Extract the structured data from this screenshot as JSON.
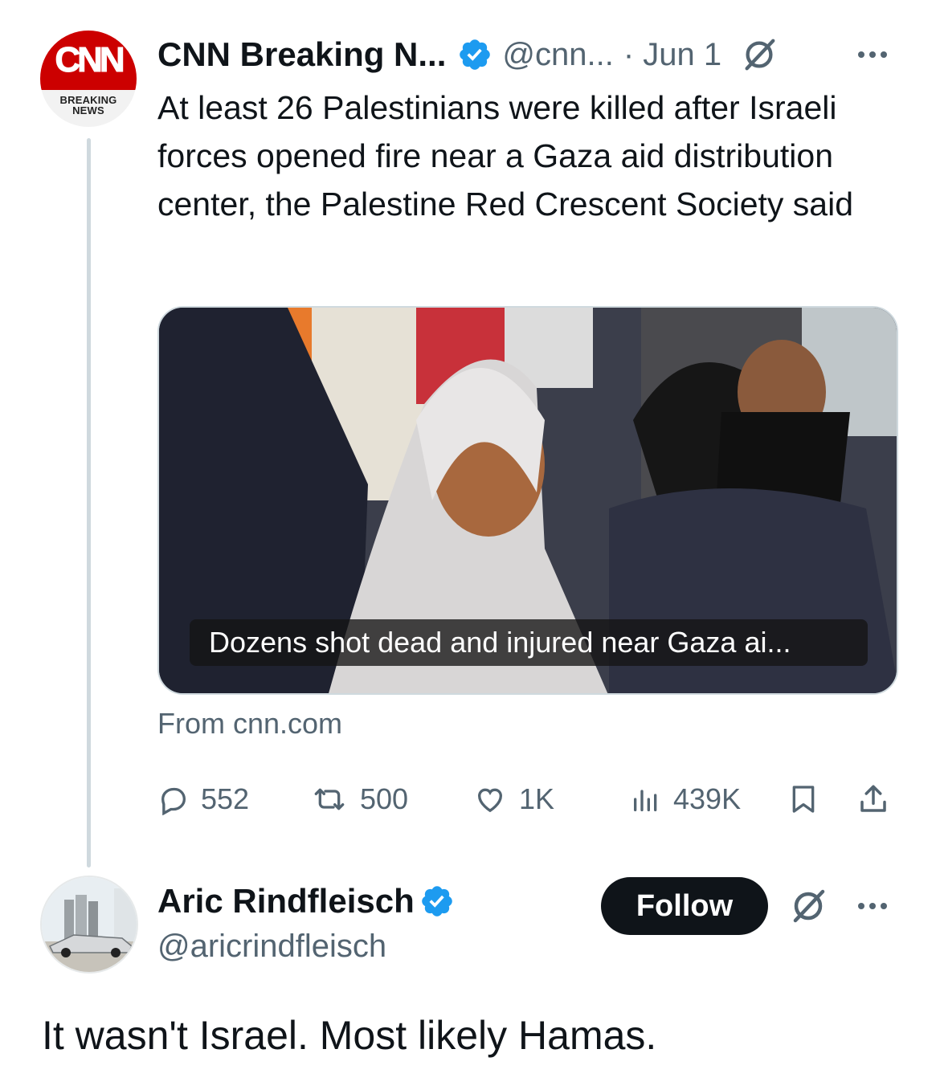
{
  "tweet": {
    "author_name": "CNN Breaking N...",
    "avatar_logo": "CNN",
    "avatar_caption_line1": "BREAKING",
    "avatar_caption_line2": "NEWS",
    "handle": "@cnn...",
    "date": "· Jun 1",
    "text": "At least 26 Palestinians were killed after Israeli forces opened fire near a Gaza aid distribution center, the Palestine Red Crescent Society said",
    "media_caption": "Dozens shot dead and injured near Gaza ai...",
    "source": "From cnn.com",
    "stats": {
      "replies": "552",
      "reposts": "500",
      "likes": "1K",
      "views": "439K"
    },
    "icons": [
      "verified-badge-icon",
      "grok-icon",
      "more-icon",
      "reply-icon",
      "repost-icon",
      "like-icon",
      "views-icon",
      "bookmark-icon",
      "share-icon"
    ]
  },
  "reply": {
    "author_name": "Aric Rindfleisch",
    "handle": "@aricrindfleisch",
    "follow_label": "Follow",
    "text": "It wasn't Israel. Most likely Hamas."
  },
  "colors": {
    "verified": "#1d9bf0",
    "text_primary": "#0f1419",
    "text_secondary": "#536471",
    "cnn_red": "#cc0000",
    "thread_line": "#cfd9de"
  }
}
